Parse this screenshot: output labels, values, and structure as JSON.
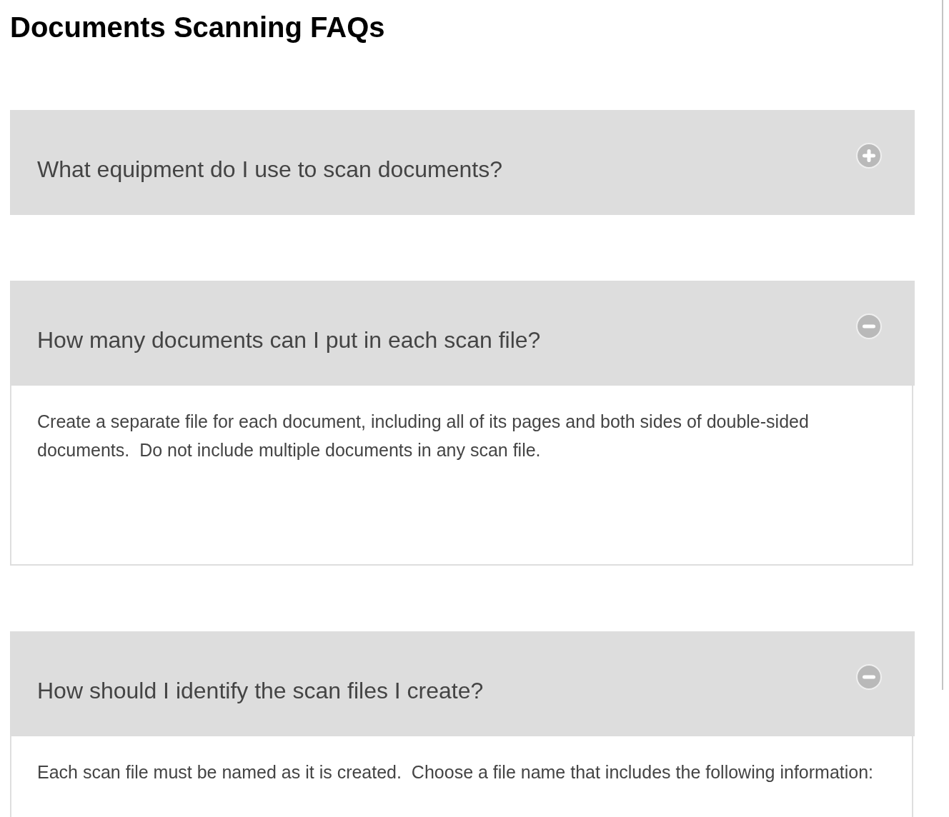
{
  "title": "Documents Scanning FAQs",
  "faqs": [
    {
      "question": "What equipment do I use to scan documents?",
      "expanded": false
    },
    {
      "question": "How many documents can I put in each scan file?",
      "expanded": true,
      "answer": "Create a separate file for each document, including all of its pages and both sides of double-sided documents.  Do not include multiple documents in any scan file."
    },
    {
      "question": "How should I identify the scan files I create?",
      "expanded": true,
      "answer": "Each scan file must be named as it is created.  Choose a file name that includes the following information:"
    }
  ]
}
